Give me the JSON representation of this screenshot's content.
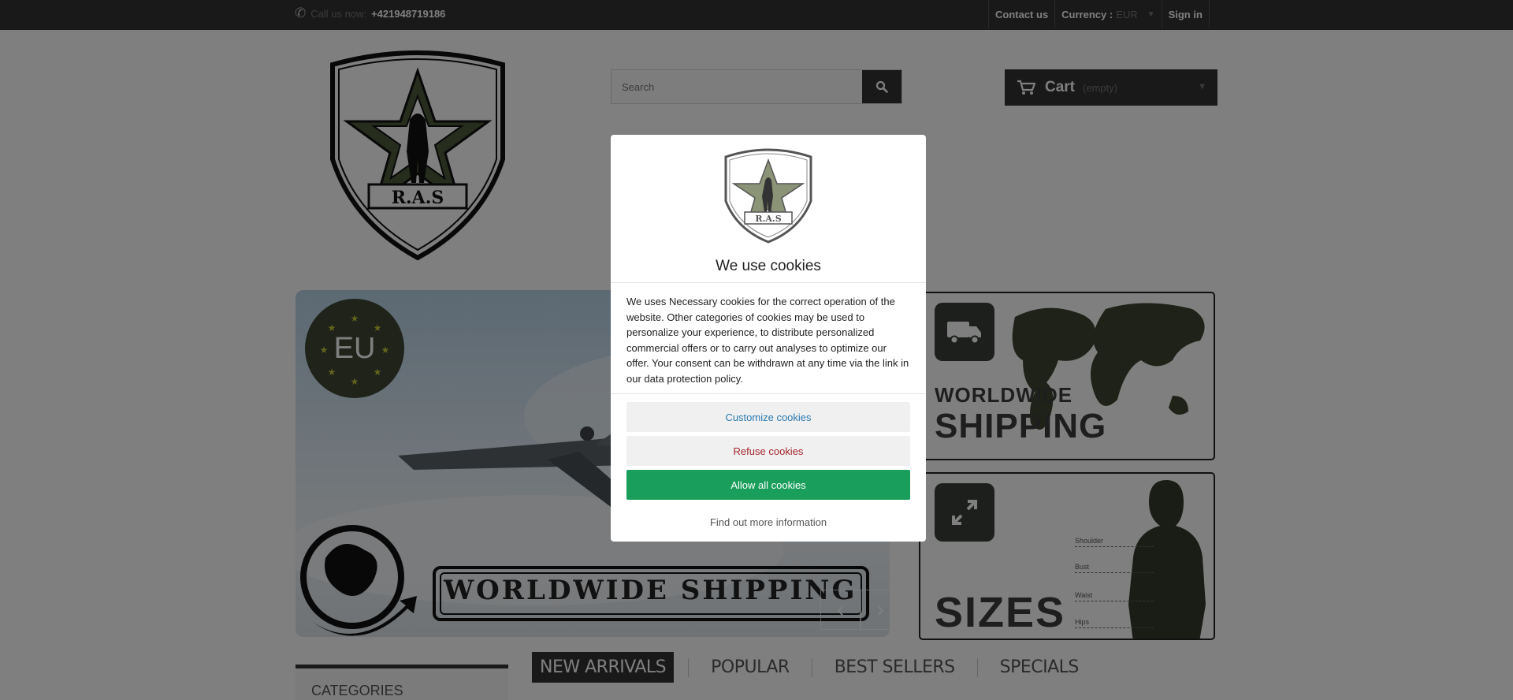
{
  "topbar": {
    "call_label": "Call us now:",
    "phone": "+421948719186",
    "contact": "Contact us",
    "currency_label": "Currency :",
    "currency_value": "EUR",
    "sign_in": "Sign in"
  },
  "header": {
    "logo_text": "R.A.S",
    "search_placeholder": "Search",
    "cart_label": "Cart",
    "cart_state": "(empty)"
  },
  "slider": {
    "badge_text": "EU",
    "caption": "WORLDWIDE SHIPPING",
    "prev": "‹",
    "next": "›"
  },
  "banners": {
    "shipping_sub": "WORLDWIDE",
    "shipping_main": "SHIPPING",
    "sizes_main": "SIZES",
    "measures": [
      "Shoulder",
      "Bust",
      "Waist",
      "Hips"
    ]
  },
  "categories": {
    "title": "CATEGORIES"
  },
  "tabs": [
    "NEW ARRIVALS",
    "POPULAR",
    "BEST SELLERS",
    "SPECIALS"
  ],
  "cookie_modal": {
    "title": "We use cookies",
    "body": "We uses Necessary cookies for the correct operation of the website. Other categories of cookies may be used to personalize your experience, to distribute personalized commercial offers or to carry out analyses to optimize our offer. Your consent can be withdrawn at any time via the link in our data protection policy.",
    "customize": "Customize cookies",
    "refuse": "Refuse cookies",
    "allow": "Allow all cookies",
    "more": "Find out more information"
  },
  "colors": {
    "topbar": "#333333",
    "accent_green": "#1a9e5c",
    "refuse_red": "#a4272d",
    "customize_blue": "#2a7ab0",
    "logo_green": "#4c5a3a"
  }
}
